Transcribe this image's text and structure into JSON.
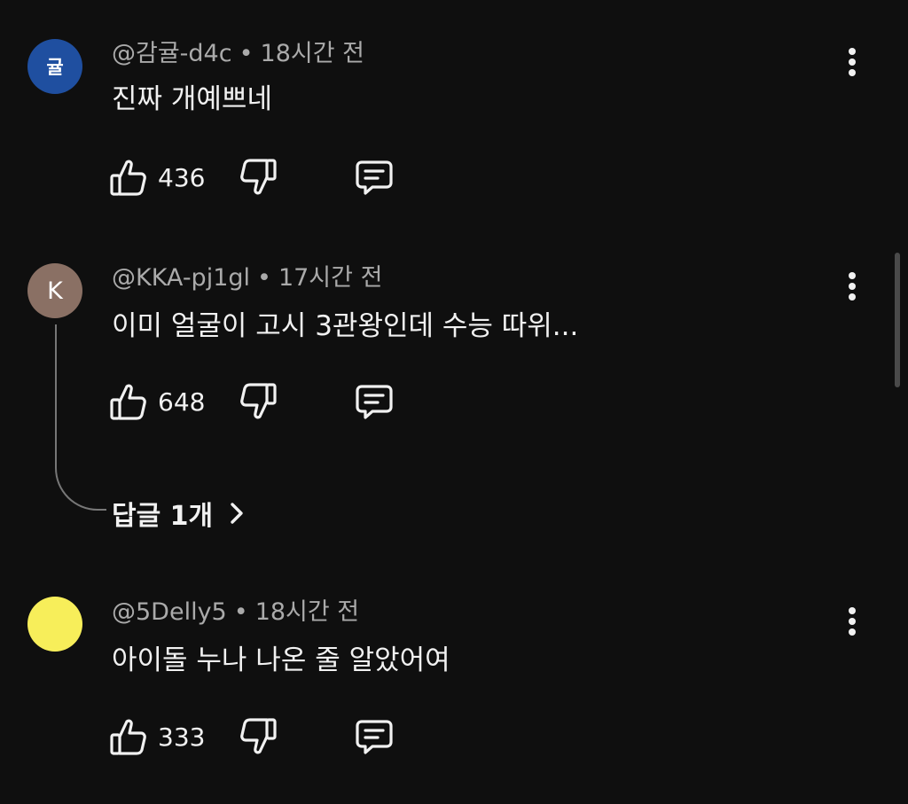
{
  "comments": [
    {
      "avatar_text": "귤",
      "avatar_color": "#1f4fa0",
      "author": "@감귤-d4c",
      "time": "18시간 전",
      "text": "진짜 개예쁘네",
      "likes": "436"
    },
    {
      "avatar_text": "K",
      "avatar_color": "#8a7064",
      "author": "@KKA-pj1gl",
      "time": "17시간 전",
      "text": "이미 얼굴이 고시 3관왕인데 수능 따위...",
      "likes": "648",
      "replies_label": "답글 1개"
    },
    {
      "avatar_text": "",
      "avatar_color": "#f7ee5a",
      "author": "@5Delly5",
      "time": "18시간 전",
      "text": "아이돌 누나 나온 줄 알았어여",
      "likes": "333"
    }
  ],
  "header_separator": "•",
  "icons": {
    "like": "thumbs-up-icon",
    "dislike": "thumbs-down-icon",
    "reply": "reply-comment-icon",
    "more": "more-vert-icon",
    "chevron": "chevron-right-icon"
  }
}
